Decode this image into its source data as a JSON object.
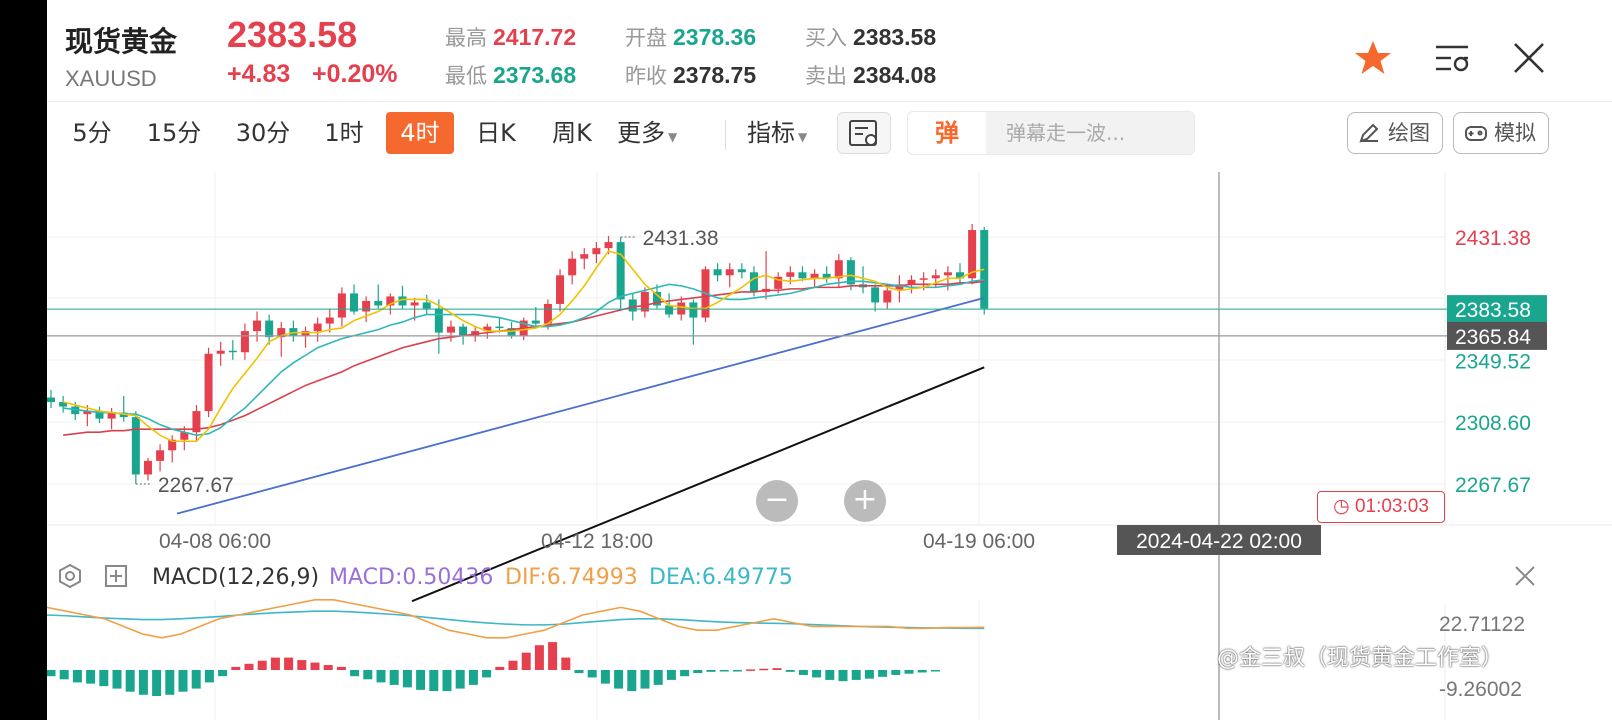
{
  "header": {
    "name": "现货黄金",
    "symbol": "XAUUSD",
    "price": "2383.58",
    "change": "+4.83",
    "change_pct": "+0.20%",
    "stats": {
      "high_label": "最高",
      "high": "2417.72",
      "low_label": "最低",
      "low": "2373.68",
      "open_label": "开盘",
      "open": "2378.36",
      "prev_label": "昨收",
      "prev": "2378.75",
      "bid_label": "买入",
      "bid": "2383.58",
      "ask_label": "卖出",
      "ask": "2384.08"
    }
  },
  "toolbar": {
    "periods": [
      "5分",
      "15分",
      "30分",
      "1时",
      "4时",
      "日K",
      "周K",
      "更多"
    ],
    "active_period": "4时",
    "indicator_label": "指标",
    "danmu_tag": "弹",
    "danmu_placeholder": "弹幕走一波...",
    "draw_label": "绘图",
    "sim_label": "模拟"
  },
  "price_axis": {
    "ticks": [
      "2431.38",
      "2349.52",
      "2308.60",
      "2267.67"
    ],
    "current_price_tag": "2383.58",
    "crosshair_price_tag": "2365.84"
  },
  "annotations": {
    "max_label": "2431.38",
    "min_label": "2267.67"
  },
  "time_axis": {
    "ticks": [
      "04-08 06:00",
      "04-12 18:00",
      "04-19 06:00"
    ],
    "crosshair_time": "2024-04-22 02:00"
  },
  "countdown": "01:03:03",
  "zoom": {
    "out": "−",
    "in": "+"
  },
  "macd": {
    "title": "MACD(12,26,9)",
    "macd_label": "MACD:0.50436",
    "dif_label": "DIF:6.74993",
    "dea_label": "DEA:6.49775",
    "axis_top": "22.71122",
    "axis_bottom": "-9.26002"
  },
  "watermark": "@金三叔（现货黄金工作室）",
  "colors": {
    "up": "#e5404e",
    "down": "#1aa68e",
    "active": "#f5692f",
    "ma5": "#f2c200",
    "ma10": "#2eb8b8",
    "ma20": "#d9404e",
    "ma60": "#4a6fcf",
    "ma120": "#111111",
    "dif": "#f0a048",
    "dea": "#3cb8c8",
    "macd_title": "#9b6fd6"
  },
  "chart_data": {
    "type": "candlestick",
    "ylim": [
      2250,
      2450
    ],
    "candles": [
      {
        "o": 2325,
        "h": 2330,
        "l": 2318,
        "c": 2322
      },
      {
        "o": 2322,
        "h": 2326,
        "l": 2315,
        "c": 2319
      },
      {
        "o": 2319,
        "h": 2322,
        "l": 2310,
        "c": 2314
      },
      {
        "o": 2314,
        "h": 2320,
        "l": 2306,
        "c": 2316
      },
      {
        "o": 2316,
        "h": 2319,
        "l": 2308,
        "c": 2311
      },
      {
        "o": 2311,
        "h": 2318,
        "l": 2304,
        "c": 2315
      },
      {
        "o": 2315,
        "h": 2326,
        "l": 2309,
        "c": 2312
      },
      {
        "o": 2312,
        "h": 2316,
        "l": 2267.67,
        "c": 2274
      },
      {
        "o": 2274,
        "h": 2285,
        "l": 2270,
        "c": 2283
      },
      {
        "o": 2283,
        "h": 2294,
        "l": 2276,
        "c": 2290
      },
      {
        "o": 2290,
        "h": 2300,
        "l": 2282,
        "c": 2297
      },
      {
        "o": 2297,
        "h": 2306,
        "l": 2290,
        "c": 2302
      },
      {
        "o": 2302,
        "h": 2320,
        "l": 2296,
        "c": 2316
      },
      {
        "o": 2316,
        "h": 2358,
        "l": 2312,
        "c": 2354
      },
      {
        "o": 2354,
        "h": 2362,
        "l": 2346,
        "c": 2356
      },
      {
        "o": 2356,
        "h": 2363,
        "l": 2350,
        "c": 2355
      },
      {
        "o": 2355,
        "h": 2374,
        "l": 2350,
        "c": 2369
      },
      {
        "o": 2369,
        "h": 2382,
        "l": 2362,
        "c": 2376
      },
      {
        "o": 2376,
        "h": 2380,
        "l": 2360,
        "c": 2365
      },
      {
        "o": 2365,
        "h": 2375,
        "l": 2352,
        "c": 2371
      },
      {
        "o": 2371,
        "h": 2376,
        "l": 2362,
        "c": 2366
      },
      {
        "o": 2366,
        "h": 2372,
        "l": 2358,
        "c": 2369
      },
      {
        "o": 2369,
        "h": 2378,
        "l": 2362,
        "c": 2374
      },
      {
        "o": 2374,
        "h": 2384,
        "l": 2368,
        "c": 2378
      },
      {
        "o": 2378,
        "h": 2398,
        "l": 2372,
        "c": 2394
      },
      {
        "o": 2394,
        "h": 2400,
        "l": 2380,
        "c": 2382
      },
      {
        "o": 2382,
        "h": 2392,
        "l": 2375,
        "c": 2389
      },
      {
        "o": 2389,
        "h": 2400,
        "l": 2384,
        "c": 2386
      },
      {
        "o": 2386,
        "h": 2394,
        "l": 2380,
        "c": 2392
      },
      {
        "o": 2392,
        "h": 2399,
        "l": 2384,
        "c": 2386
      },
      {
        "o": 2386,
        "h": 2391,
        "l": 2376,
        "c": 2388
      },
      {
        "o": 2388,
        "h": 2393,
        "l": 2380,
        "c": 2384
      },
      {
        "o": 2384,
        "h": 2390,
        "l": 2354,
        "c": 2368
      },
      {
        "o": 2368,
        "h": 2376,
        "l": 2362,
        "c": 2372
      },
      {
        "o": 2372,
        "h": 2374,
        "l": 2360,
        "c": 2366
      },
      {
        "o": 2366,
        "h": 2372,
        "l": 2362,
        "c": 2369
      },
      {
        "o": 2369,
        "h": 2374,
        "l": 2364,
        "c": 2372
      },
      {
        "o": 2372,
        "h": 2378,
        "l": 2368,
        "c": 2371
      },
      {
        "o": 2371,
        "h": 2375,
        "l": 2364,
        "c": 2366
      },
      {
        "o": 2366,
        "h": 2378,
        "l": 2363,
        "c": 2376
      },
      {
        "o": 2376,
        "h": 2385,
        "l": 2372,
        "c": 2374
      },
      {
        "o": 2374,
        "h": 2390,
        "l": 2370,
        "c": 2387
      },
      {
        "o": 2387,
        "h": 2410,
        "l": 2382,
        "c": 2406
      },
      {
        "o": 2406,
        "h": 2422,
        "l": 2400,
        "c": 2417
      },
      {
        "o": 2417,
        "h": 2424,
        "l": 2410,
        "c": 2420
      },
      {
        "o": 2420,
        "h": 2428,
        "l": 2414,
        "c": 2424
      },
      {
        "o": 2424,
        "h": 2432,
        "l": 2420,
        "c": 2428
      },
      {
        "o": 2428,
        "h": 2431.38,
        "l": 2384,
        "c": 2390
      },
      {
        "o": 2390,
        "h": 2394,
        "l": 2376,
        "c": 2382
      },
      {
        "o": 2382,
        "h": 2398,
        "l": 2378,
        "c": 2395
      },
      {
        "o": 2395,
        "h": 2400,
        "l": 2384,
        "c": 2386
      },
      {
        "o": 2386,
        "h": 2394,
        "l": 2378,
        "c": 2380
      },
      {
        "o": 2380,
        "h": 2392,
        "l": 2376,
        "c": 2388
      },
      {
        "o": 2388,
        "h": 2390,
        "l": 2360,
        "c": 2378
      },
      {
        "o": 2378,
        "h": 2412,
        "l": 2375,
        "c": 2410
      },
      {
        "o": 2410,
        "h": 2414,
        "l": 2402,
        "c": 2406
      },
      {
        "o": 2406,
        "h": 2414,
        "l": 2398,
        "c": 2410
      },
      {
        "o": 2410,
        "h": 2414,
        "l": 2404,
        "c": 2408
      },
      {
        "o": 2408,
        "h": 2412,
        "l": 2392,
        "c": 2395
      },
      {
        "o": 2395,
        "h": 2422,
        "l": 2390,
        "c": 2397
      },
      {
        "o": 2397,
        "h": 2408,
        "l": 2394,
        "c": 2405
      },
      {
        "o": 2405,
        "h": 2412,
        "l": 2400,
        "c": 2408
      },
      {
        "o": 2408,
        "h": 2412,
        "l": 2402,
        "c": 2404
      },
      {
        "o": 2404,
        "h": 2410,
        "l": 2398,
        "c": 2407
      },
      {
        "o": 2407,
        "h": 2412,
        "l": 2401,
        "c": 2404
      },
      {
        "o": 2404,
        "h": 2420,
        "l": 2398,
        "c": 2416
      },
      {
        "o": 2416,
        "h": 2418,
        "l": 2396,
        "c": 2400
      },
      {
        "o": 2400,
        "h": 2412,
        "l": 2394,
        "c": 2398
      },
      {
        "o": 2398,
        "h": 2400,
        "l": 2382,
        "c": 2388
      },
      {
        "o": 2388,
        "h": 2398,
        "l": 2384,
        "c": 2396
      },
      {
        "o": 2396,
        "h": 2406,
        "l": 2388,
        "c": 2400
      },
      {
        "o": 2400,
        "h": 2406,
        "l": 2394,
        "c": 2403
      },
      {
        "o": 2403,
        "h": 2408,
        "l": 2396,
        "c": 2404
      },
      {
        "o": 2404,
        "h": 2410,
        "l": 2398,
        "c": 2406
      },
      {
        "o": 2406,
        "h": 2412,
        "l": 2396,
        "c": 2408
      },
      {
        "o": 2408,
        "h": 2414,
        "l": 2400,
        "c": 2404
      },
      {
        "o": 2404,
        "h": 2440,
        "l": 2400,
        "c": 2436
      },
      {
        "o": 2436,
        "h": 2438,
        "l": 2380,
        "c": 2384
      }
    ],
    "ma5": [
      2322,
      2320,
      2318,
      2316,
      2315,
      2314,
      2313,
      2306,
      2300,
      2296,
      2296,
      2296,
      2304,
      2318,
      2331,
      2341,
      2351,
      2362,
      2366,
      2368,
      2368,
      2368,
      2370,
      2371,
      2376,
      2379,
      2382,
      2387,
      2390,
      2390,
      2390,
      2386,
      2381,
      2376,
      2372,
      2369,
      2369,
      2369,
      2370,
      2371,
      2374,
      2380,
      2389,
      2399,
      2411,
      2422,
      2420,
      2410,
      2400,
      2393,
      2386,
      2385,
      2384,
      2384,
      2388,
      2393,
      2398,
      2404,
      2406,
      2403,
      2402,
      2403,
      2404,
      2404,
      2405,
      2406,
      2404,
      2402,
      2398,
      2396,
      2397,
      2398,
      2401,
      2404,
      2404,
      2408,
      2410
    ],
    "ma10": [
      2318,
      2317,
      2316,
      2315,
      2315,
      2314,
      2314,
      2311,
      2307,
      2304,
      2302,
      2300,
      2301,
      2305,
      2312,
      2318,
      2326,
      2334,
      2342,
      2348,
      2353,
      2358,
      2361,
      2364,
      2366,
      2368,
      2370,
      2373,
      2375,
      2378,
      2380,
      2380,
      2380,
      2380,
      2380,
      2379,
      2378,
      2376,
      2374,
      2372,
      2372,
      2373,
      2375,
      2378,
      2382,
      2388,
      2392,
      2394,
      2396,
      2398,
      2400,
      2399,
      2397,
      2394,
      2391,
      2390,
      2390,
      2391,
      2392,
      2393,
      2394,
      2396,
      2398,
      2400,
      2401,
      2402,
      2402,
      2401,
      2400,
      2399,
      2398,
      2398,
      2398,
      2399,
      2400,
      2402,
      2403
    ],
    "ma20": [
      2300,
      2301,
      2302,
      2302,
      2303,
      2303,
      2304,
      2304,
      2304,
      2304,
      2304,
      2304,
      2305,
      2307,
      2310,
      2313,
      2317,
      2321,
      2325,
      2329,
      2333,
      2336,
      2339,
      2342,
      2346,
      2349,
      2352,
      2355,
      2358,
      2360,
      2362,
      2364,
      2365,
      2366,
      2367,
      2368,
      2369,
      2370,
      2371,
      2372,
      2373,
      2374,
      2375,
      2377,
      2379,
      2381,
      2383,
      2385,
      2386,
      2388,
      2389,
      2390,
      2391,
      2392,
      2393,
      2394,
      2395,
      2395,
      2396,
      2396,
      2397,
      2397,
      2398,
      2398,
      2398,
      2399,
      2399,
      2399,
      2399,
      2399,
      2400,
      2400,
      2400,
      2400,
      2401,
      2401,
      2402
    ],
    "ma60_range": [
      2248,
      2391
    ],
    "ma120_range": [
      2190,
      2345
    ],
    "macd_hist": [
      -1,
      -1.5,
      -2,
      -2.2,
      -2.6,
      -3,
      -3.5,
      -4,
      -4.2,
      -4,
      -3.5,
      -3,
      -2,
      -1,
      0.5,
      1,
      1.5,
      2,
      2,
      1.6,
      1.2,
      0.8,
      0.5,
      -1,
      -1.5,
      -2,
      -2.4,
      -2.8,
      -3.2,
      -3.4,
      -3.4,
      -3,
      -2.4,
      -1.2,
      0.5,
      1.5,
      2.8,
      4,
      4.5,
      2,
      -0.5,
      -1.2,
      -2.2,
      -3,
      -3.4,
      -3,
      -2.4,
      -1.6,
      -1,
      -0.5,
      -0.3,
      -0.2,
      -0.1,
      0.1,
      0.2,
      0.3,
      -0.3,
      -0.8,
      -1.2,
      -1.6,
      -1.8,
      -1.6,
      -1.4,
      -1.1,
      -0.8,
      -0.6,
      -0.4,
      -0.2
    ],
    "dif": [
      12,
      11,
      10,
      9,
      7,
      5,
      4,
      5,
      7,
      9,
      10,
      11,
      12,
      13,
      14,
      14,
      13,
      12,
      11,
      10,
      8,
      6,
      5,
      4,
      4,
      5,
      6,
      8,
      10,
      11,
      12,
      11,
      9,
      7,
      6,
      6,
      7,
      8,
      9,
      8,
      7,
      7,
      7,
      7,
      7,
      6.5,
      6.5,
      6.7,
      6.7,
      6.75
    ],
    "dea": [
      10,
      9.8,
      9.5,
      9.2,
      9,
      8.8,
      8.8,
      9,
      9.3,
      9.6,
      10,
      10.3,
      10.6,
      10.8,
      11,
      11,
      10.8,
      10.5,
      10.2,
      9.8,
      9.3,
      8.8,
      8.3,
      7.9,
      7.6,
      7.4,
      7.4,
      7.6,
      8,
      8.4,
      8.8,
      9,
      9,
      8.8,
      8.5,
      8.2,
      8,
      7.9,
      7.8,
      7.7,
      7.5,
      7.3,
      7.1,
      6.9,
      6.8,
      6.7,
      6.6,
      6.55,
      6.5,
      6.5
    ]
  }
}
